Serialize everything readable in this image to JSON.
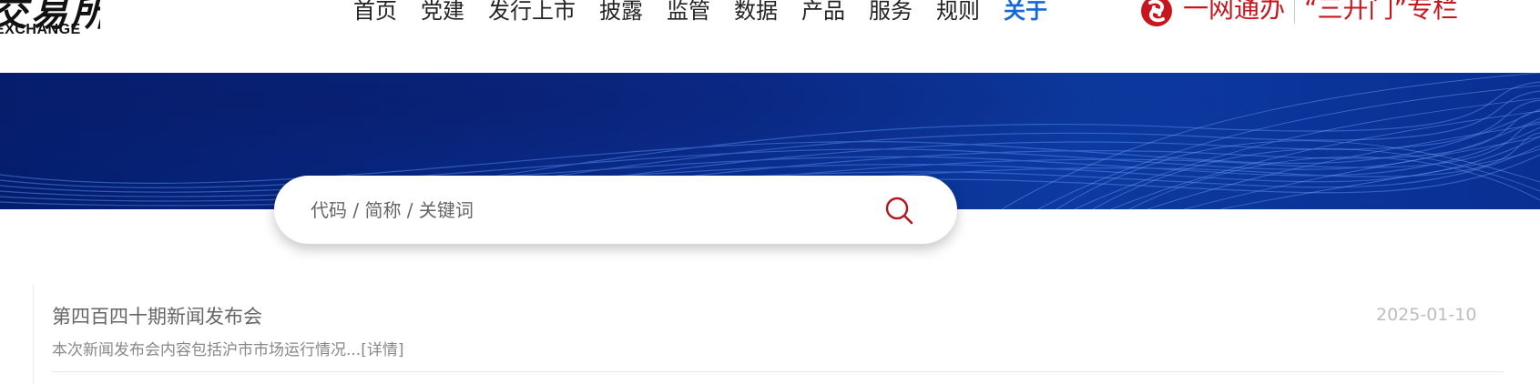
{
  "header": {
    "logo_cn": "交易所",
    "logo_en": "EXCHANGE",
    "nav": [
      {
        "label": "首页"
      },
      {
        "label": "党建"
      },
      {
        "label": "发行上市"
      },
      {
        "label": "披露"
      },
      {
        "label": "监管"
      },
      {
        "label": "数据"
      },
      {
        "label": "产品"
      },
      {
        "label": "服务"
      },
      {
        "label": "规则"
      },
      {
        "label": "关于"
      }
    ],
    "active_nav": "关于",
    "portal_label": "一网通办",
    "special_label": "“三开门”专栏"
  },
  "search": {
    "placeholder": "代码 / 简称 / 关键词",
    "value": ""
  },
  "news": [
    {
      "title": "第四百四十期新闻发布会",
      "date": "2025-01-10",
      "summary": "本次新闻发布会内容包括沪市市场运行情况...",
      "detail_label": "[详情]"
    }
  ],
  "colors": {
    "brand_red": "#c7161e",
    "accent_blue": "#1667d8",
    "banner_blue": "#0a2c8c"
  },
  "icons": {
    "portal": "portal-logo-icon",
    "search": "search-icon"
  }
}
